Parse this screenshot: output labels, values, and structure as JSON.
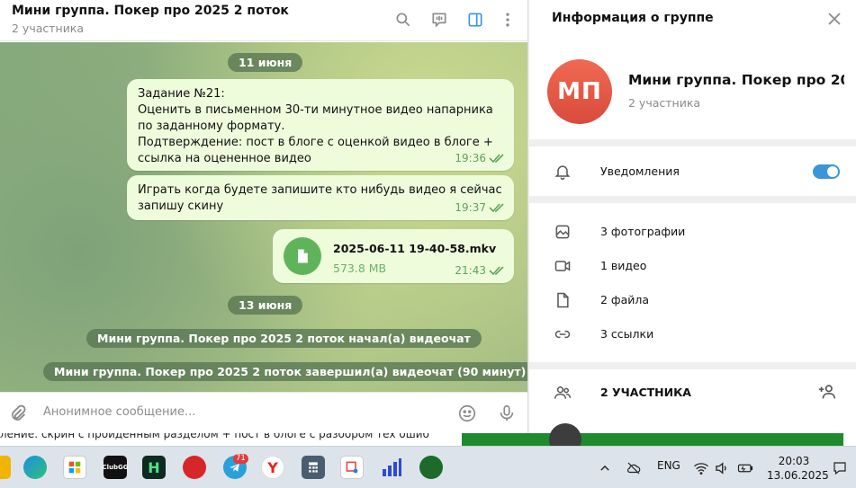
{
  "chat": {
    "title": "Мини группа. Покер про 2025 2 поток",
    "subtitle": "2 участника",
    "date_1": "11 июня",
    "date_2": "13 июня",
    "messages": [
      {
        "text": "Задание №21:\nОценить в письменном 30-ти минутное видео напарника по заданному формату.\nПодтверждение: пост в блоге с оценкой видео в блоге + ссылка на оцененное видео",
        "time": "19:36"
      },
      {
        "text": "Играть когда будете запишите кто нибудь видео я сейчас запишу скину",
        "time": "19:37"
      }
    ],
    "file": {
      "name": "2025-06-11 19-40-58.mkv",
      "size": "573.8 MB",
      "time": "21:43"
    },
    "service_1": "Мини группа. Покер про 2025 2 поток начал(а) видеочат",
    "service_2": "Мини группа. Покер про 2025 2 поток завершил(а) видеочат (90 минут)",
    "input_placeholder": "Анонимное сообщение..."
  },
  "info": {
    "title": "Информация о группе",
    "avatar_initials": "МП",
    "group_name": "Мини группа. Покер про 20...",
    "group_subtitle": "2 участника",
    "notifications_label": "Уведомления",
    "notifications_on": true,
    "media": [
      {
        "label": "3 фотографии",
        "icon": "photo-icon"
      },
      {
        "label": "1 видео",
        "icon": "video-icon"
      },
      {
        "label": "2 файла",
        "icon": "file-icon"
      },
      {
        "label": "3 ссылки",
        "icon": "link-icon"
      }
    ],
    "members_label": "2 УЧАСТНИКА"
  },
  "background_doc_text": "ление:  скрин с пройденным разделом + пост в блоге с разбором тех ошиб",
  "taskbar": {
    "telegram_badge": "71",
    "app_label_2": "ClubGG",
    "language": "ENG",
    "time": "20:03",
    "date": "13.06.2025"
  },
  "colors": {
    "accent": "#3a96d8",
    "bubble": "#eefcdc",
    "avatar": "#e2543f",
    "check": "#5da55a"
  }
}
